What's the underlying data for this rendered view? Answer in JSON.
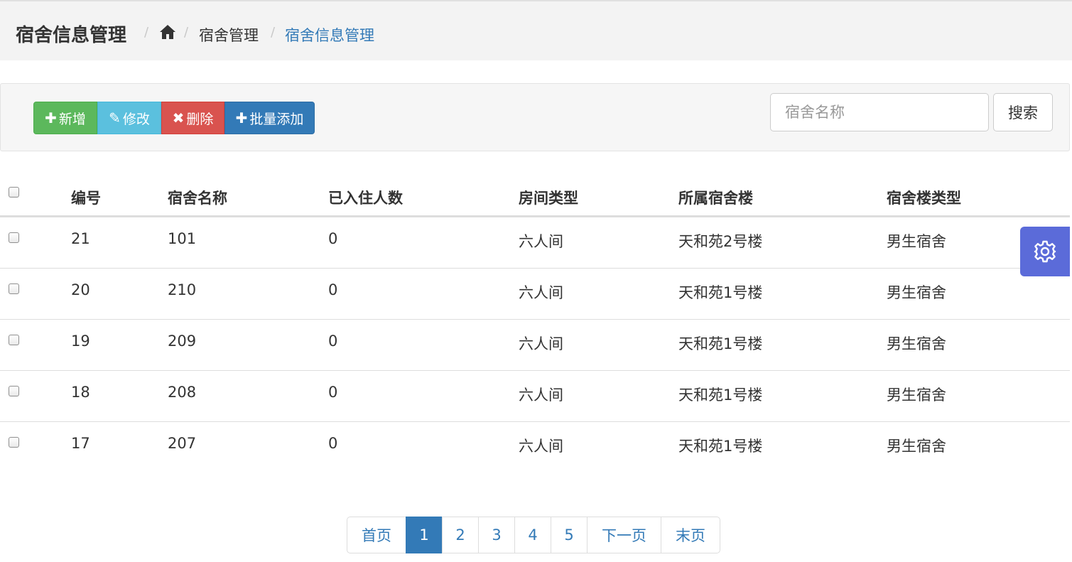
{
  "header": {
    "title": "宿舍信息管理",
    "breadcrumb": [
      "宿舍管理",
      "宿舍信息管理"
    ]
  },
  "toolbar": {
    "add_label": "新增",
    "edit_label": "修改",
    "delete_label": "删除",
    "batch_add_label": "批量添加",
    "search_placeholder": "宿舍名称",
    "search_value": "",
    "search_button": "搜索"
  },
  "table": {
    "columns": [
      "编号",
      "宿舍名称",
      "已入住人数",
      "房间类型",
      "所属宿舍楼",
      "宿舍楼类型"
    ],
    "rows": [
      {
        "id": "21",
        "name": "101",
        "occupied": "0",
        "room_type": "六人间",
        "building": "天和苑2号楼",
        "building_type": "男生宿舍"
      },
      {
        "id": "20",
        "name": "210",
        "occupied": "0",
        "room_type": "六人间",
        "building": "天和苑1号楼",
        "building_type": "男生宿舍"
      },
      {
        "id": "19",
        "name": "209",
        "occupied": "0",
        "room_type": "六人间",
        "building": "天和苑1号楼",
        "building_type": "男生宿舍"
      },
      {
        "id": "18",
        "name": "208",
        "occupied": "0",
        "room_type": "六人间",
        "building": "天和苑1号楼",
        "building_type": "男生宿舍"
      },
      {
        "id": "17",
        "name": "207",
        "occupied": "0",
        "room_type": "六人间",
        "building": "天和苑1号楼",
        "building_type": "男生宿舍"
      }
    ]
  },
  "pagination": {
    "first": "首页",
    "pages": [
      "1",
      "2",
      "3",
      "4",
      "5"
    ],
    "current": "1",
    "next": "下一页",
    "last": "末页"
  },
  "colors": {
    "success": "#5cb85c",
    "info": "#5bc0de",
    "danger": "#d9534f",
    "primary": "#337ab7",
    "settings_tab": "#5b6bd9"
  },
  "icons": {
    "breadcrumb_home": "home-icon",
    "add": "plus-icon",
    "edit": "pencil-icon",
    "delete": "remove-icon",
    "batch_add": "plus-icon",
    "settings": "gear-icon"
  }
}
